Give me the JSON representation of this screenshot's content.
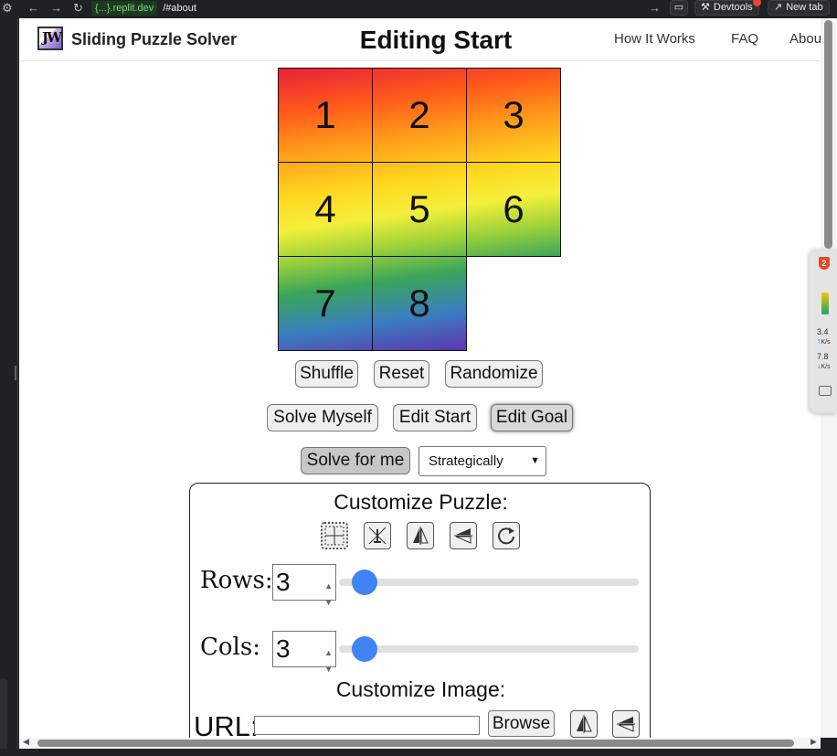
{
  "browser": {
    "url_host": "{...}.replit.dev",
    "url_path": "/#about",
    "devtools_label": "Devtools",
    "new_tab_label": "New tab"
  },
  "header": {
    "brand": "Sliding Puzzle Solver",
    "page_title": "Editing Start",
    "nav": [
      "How It Works",
      "FAQ",
      "About"
    ]
  },
  "puzzle": {
    "rows": 3,
    "cols": 3,
    "tiles": [
      "1",
      "2",
      "3",
      "4",
      "5",
      "6",
      "7",
      "8",
      ""
    ]
  },
  "controls": {
    "shuffle": "Shuffle",
    "reset": "Reset",
    "randomize": "Randomize",
    "solve_myself": "Solve Myself",
    "edit_start": "Edit Start",
    "edit_goal": "Edit Goal",
    "solve_for_me": "Solve for me",
    "strategy_selected": "Strategically"
  },
  "customize": {
    "puzzle_title": "Customize Puzzle:",
    "rows_label": "Rows:",
    "rows_value": "3",
    "cols_label": "Cols:",
    "cols_value": "3",
    "image_title": "Customize Image:",
    "url_label": "URL:",
    "url_value": "",
    "browse": "Browse"
  },
  "extension": {
    "shield_count": "2",
    "upload_speed": "3.4",
    "download_speed": "7.8",
    "speed_unit": "K/s"
  },
  "colors": {
    "slider_accent": "#3f84f4",
    "host_green": "#7bd67b"
  }
}
